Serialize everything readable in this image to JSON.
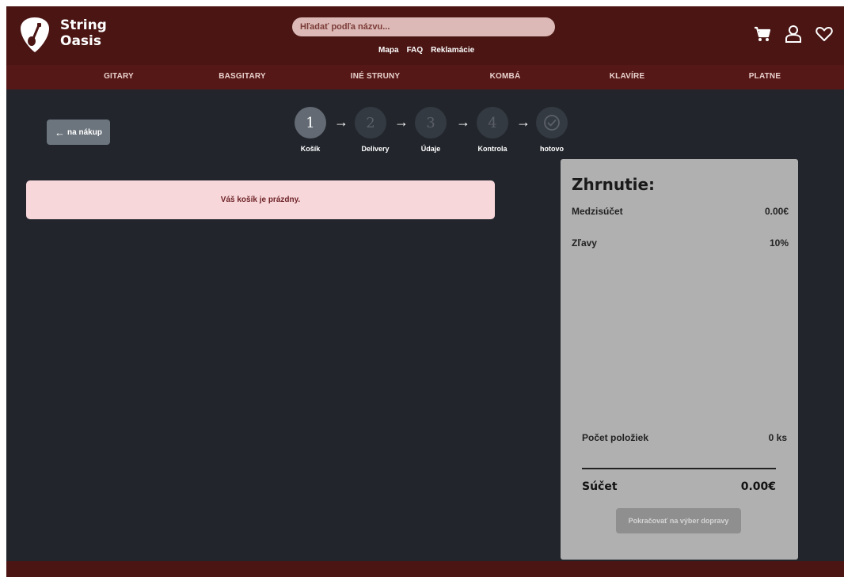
{
  "brand": {
    "line1": "String",
    "line2": "Oasis"
  },
  "search": {
    "placeholder": "Hľadať podľa názvu..."
  },
  "top_links": [
    "Mapa",
    "FAQ",
    "Reklamácie"
  ],
  "categories": [
    "GITARY",
    "BASGITARY",
    "INÉ STRUNY",
    "KOMBÁ",
    "KLAVÍRE",
    "PLATNE"
  ],
  "back_button": {
    "arrow": "←",
    "label": "na nákup"
  },
  "steps": [
    {
      "number": "1",
      "label": "Košík"
    },
    {
      "number": "2",
      "label": "Delivery"
    },
    {
      "number": "3",
      "label": "Údaje"
    },
    {
      "number": "4",
      "label": "Kontrola"
    },
    {
      "number": "",
      "label": "hotovo"
    }
  ],
  "step_arrow": "→",
  "alert": {
    "message": "Váš košík je prázdny."
  },
  "summary": {
    "title": "Zhrnutie:",
    "subtotal_label": "Medzisúčet",
    "subtotal_value": "0.00€",
    "discount_label": "Zľavy",
    "discount_value": "10%",
    "items_label": "Počet položiek",
    "items_value": "0 ks",
    "total_label": "Súčet",
    "total_value": "0.00€",
    "continue_label": "Pokračovať na výber dopravy"
  },
  "colors": {
    "header": "#4a1513",
    "nav": "#561816",
    "background": "#22262c",
    "alert_bg": "#f8d7da",
    "summary_bg": "#b0b0b0"
  },
  "icons": [
    "guitar-pick-logo-icon",
    "cart-icon",
    "user-icon",
    "heart-icon",
    "check-circle-icon",
    "arrow-left-icon",
    "arrow-right-icon"
  ]
}
